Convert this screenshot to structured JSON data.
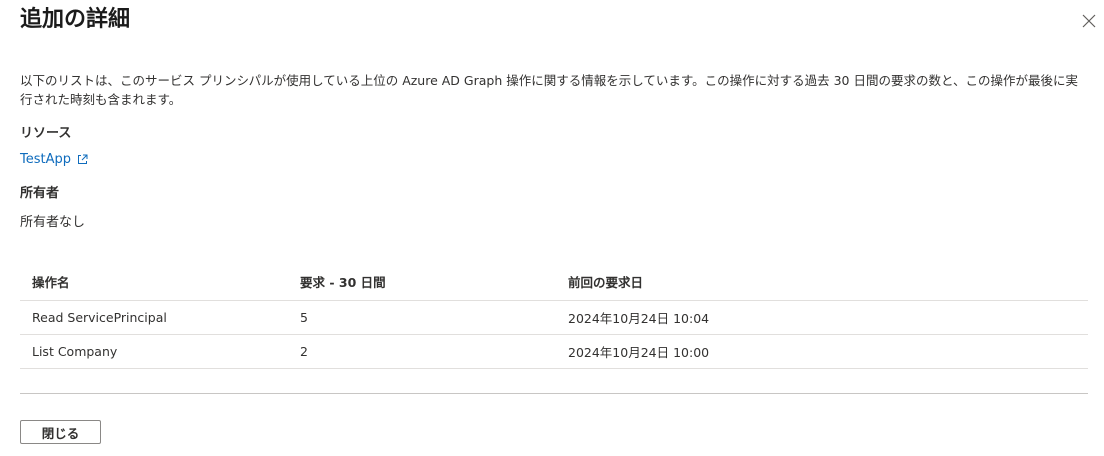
{
  "panel": {
    "title": "追加の詳細",
    "close_icon": "close-icon"
  },
  "description": "以下のリストは、このサービス プリンシパルが使用している上位の Azure AD Graph 操作に関する情報を示しています。この操作に対する過去 30 日間の要求の数と、この操作が最後に実行された時刻も含まれます。",
  "resource": {
    "label": "リソース",
    "link_text": "TestApp",
    "link_icon": "external-link-icon"
  },
  "owner": {
    "label": "所有者",
    "value": "所有者なし"
  },
  "table": {
    "headers": [
      "操作名",
      "要求 - 30 日間",
      "前回の要求日"
    ],
    "rows": [
      [
        "Read ServicePrincipal",
        "5",
        "2024年10月24日 10:04"
      ],
      [
        "List Company",
        "2",
        "2024年10月24日 10:00"
      ]
    ]
  },
  "footer": {
    "close_label": "閉じる"
  },
  "colors": {
    "link": "#0f6cbd",
    "text": "#323130",
    "border": "#e1dfdd"
  }
}
